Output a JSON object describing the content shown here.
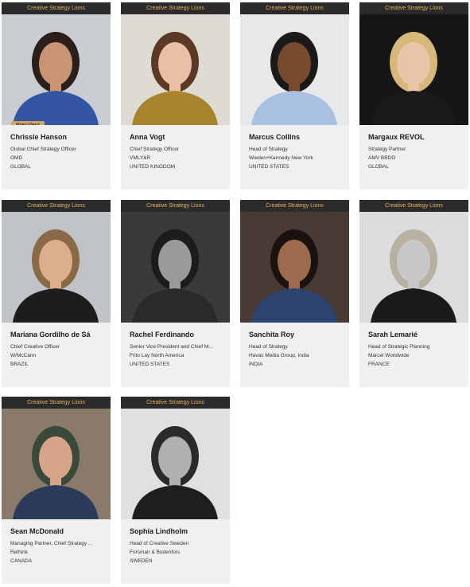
{
  "header_label": "Creative Strategy Lions",
  "president_badge": "President",
  "people": [
    {
      "name": "Chrissie Hanson",
      "title": "Global Chief Strategy Officer",
      "company": "OMD",
      "country": "GLOBAL",
      "photo_bg": "#c9cdd1",
      "shirt": "#3454a4",
      "hair": "#2a1f1a",
      "skin": "#c99473"
    },
    {
      "name": "Anna Vogt",
      "title": "Chief Strategy Officer",
      "company": "VMLY&R",
      "country": "UNITED KINGDOM",
      "photo_bg": "#dedad4",
      "shirt": "#a8842c",
      "hair": "#5a3a26",
      "skin": "#e8c0a4"
    },
    {
      "name": "Marcus Collins",
      "title": "Head of Strategy",
      "company": "Wieden+Kennedy New York",
      "country": "UNITED STATES",
      "photo_bg": "#e6e8ea",
      "shirt": "#a9c1e0",
      "hair": "#1a1a1a",
      "skin": "#7a4a2e"
    },
    {
      "name": "Margaux REVOL",
      "title": "Strategy Partner",
      "company": "AMV BBDO",
      "country": "GLOBAL",
      "photo_bg": "#161616",
      "shirt": "#1a1a1a",
      "hair": "#d7b77a",
      "skin": "#e9c4a8"
    },
    {
      "name": "Mariana Gordilho de Sá",
      "title": "Chief Creative Officer",
      "company": "W/McCann",
      "country": "BRAZIL",
      "photo_bg": "#bfc3c6",
      "shirt": "#1d1d1d",
      "hair": "#8a6a46",
      "skin": "#dcae8c"
    },
    {
      "name": "Rachel Ferdinando",
      "title": "Senior Vice President and Chief M...",
      "company": "Frito Lay North America",
      "country": "UNITED STATES",
      "photo_bg": "#3a3a3a",
      "shirt": "#2a2a2a",
      "hair": "#1c1c1c",
      "skin": "#9a9a9a"
    },
    {
      "name": "Sanchita Roy",
      "title": "Head of Strategy",
      "company": "Havas Media Group, India",
      "country": "INDIA",
      "photo_bg": "#4a3a36",
      "shirt": "#2c4470",
      "hair": "#1a1210",
      "skin": "#9c6a4c"
    },
    {
      "name": "Sarah Lemarié",
      "title": "Head of Strategic Planning",
      "company": "Marcel Worldwide",
      "country": "FRANCE",
      "photo_bg": "#dcdcdc",
      "shirt": "#1a1a1a",
      "hair": "#b8b0a0",
      "skin": "#c8c8c8"
    },
    {
      "name": "Sean McDonald",
      "title": "Managing Partner, Chief Strategy ...",
      "company": "Rethink",
      "country": "CANADA",
      "photo_bg": "#8a7a6a",
      "shirt": "#2a3c5a",
      "hair": "#3a4a3a",
      "skin": "#d6a488"
    },
    {
      "name": "Sophia Lindholm",
      "title": "Head of Creative Sweden",
      "company": "Forsman & Bodenfors",
      "country": "SWEDEN",
      "photo_bg": "#e0e0e0",
      "shirt": "#1e1e1e",
      "hair": "#2a2a2a",
      "skin": "#b0b0b0"
    }
  ]
}
